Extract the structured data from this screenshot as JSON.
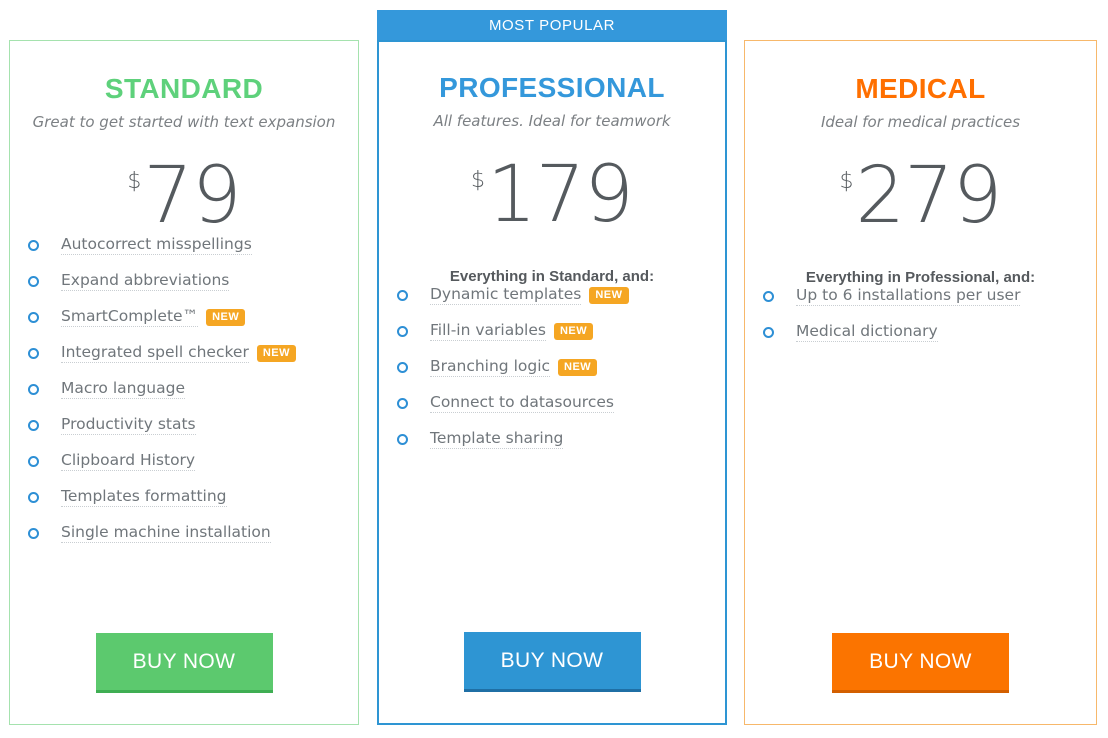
{
  "popular_banner": {
    "label": "MOST POPULAR"
  },
  "plans": [
    {
      "id": "standard",
      "title": "STANDARD",
      "subtitle": "Great to get started with text expansion",
      "currency": "$",
      "price": "79",
      "accent_color": "#5ed17b",
      "intro": "",
      "features": [
        {
          "label": "Autocorrect misspellings",
          "badge": ""
        },
        {
          "label": "Expand abbreviations",
          "badge": ""
        },
        {
          "label": "SmartComplete™",
          "badge": "NEW"
        },
        {
          "label": "Integrated spell checker",
          "badge": "NEW"
        },
        {
          "label": "Macro language",
          "badge": ""
        },
        {
          "label": "Productivity stats",
          "badge": ""
        },
        {
          "label": "Clipboard History",
          "badge": ""
        },
        {
          "label": "Templates formatting",
          "badge": ""
        },
        {
          "label": "Single machine installation",
          "badge": ""
        }
      ],
      "buy_label": "BUY NOW",
      "button_color": "#5cc96e"
    },
    {
      "id": "professional",
      "title": "PROFESSIONAL",
      "subtitle": "All features. Ideal for teamwork",
      "currency": "$",
      "price": "179",
      "accent_color": "#3498db",
      "intro": "Everything in Standard, and:",
      "features": [
        {
          "label": "Dynamic templates",
          "badge": "NEW"
        },
        {
          "label": "Fill-in variables",
          "badge": "NEW"
        },
        {
          "label": "Branching logic",
          "badge": "NEW"
        },
        {
          "label": "Connect to datasources",
          "badge": ""
        },
        {
          "label": "Template sharing",
          "badge": ""
        }
      ],
      "buy_label": "BUY NOW",
      "button_color": "#2e95d3"
    },
    {
      "id": "medical",
      "title": "MEDICAL",
      "subtitle": "Ideal for medical practices",
      "currency": "$",
      "price": "279",
      "accent_color": "#ff6f00",
      "intro": "Everything in Professional, and:",
      "features": [
        {
          "label": "Up to 6 installations per user",
          "badge": ""
        },
        {
          "label": "Medical dictionary",
          "badge": ""
        }
      ],
      "buy_label": "BUY NOW",
      "button_color": "#fb7400"
    }
  ],
  "icons": {
    "bullet": "ring-bullet-icon"
  }
}
